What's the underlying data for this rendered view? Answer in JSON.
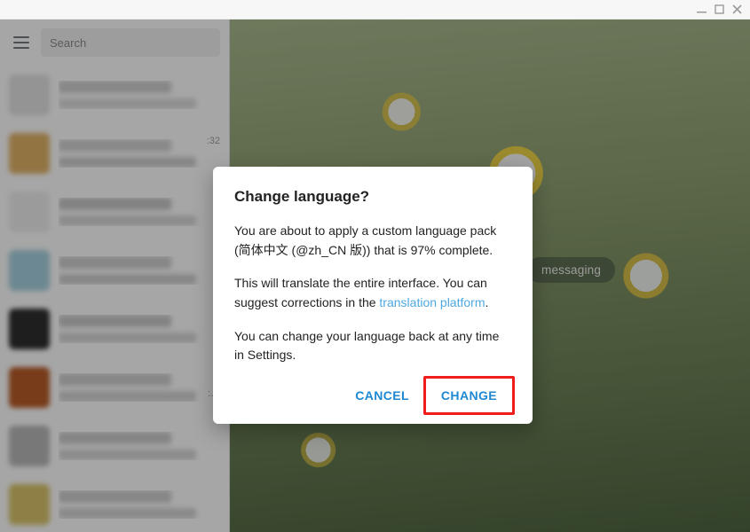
{
  "window": {
    "title": ""
  },
  "sidebar": {
    "search_placeholder": "Search",
    "chats": [
      {
        "time": "",
        "avatar_bg": "#e3e3e3",
        "title_bg": "#cfcfcf",
        "preview_bg": "#dcdcdc"
      },
      {
        "time": ":32",
        "avatar_bg": "#e1b368",
        "title_bg": "#d3d3d3",
        "preview_bg": "#cfcfcf"
      },
      {
        "time": "",
        "avatar_bg": "#efefef",
        "title_bg": "#c8c8c8",
        "preview_bg": "#d7d7d7"
      },
      {
        "time": "",
        "avatar_bg": "#a7d2e0",
        "title_bg": "#cfcfcf",
        "preview_bg": "#d0d0d0"
      },
      {
        "time": "",
        "avatar_bg": "#2e2e2e",
        "title_bg": "#cacaca",
        "preview_bg": "#d8d8d8"
      },
      {
        "time": "",
        "avatar_bg": "#b85c28",
        "title_bg": "#cfcfcf",
        "preview_bg": "#d4d4d4",
        "dots": ":…"
      },
      {
        "time": "",
        "avatar_bg": "#b9b9b9",
        "title_bg": "#cdcdcd",
        "preview_bg": "#d7d7d7"
      },
      {
        "time": "",
        "avatar_bg": "#d9c46a",
        "title_bg": "#cfcfcf",
        "preview_bg": "#d4d4d4"
      }
    ]
  },
  "main": {
    "welcome_text": "messaging"
  },
  "dialog": {
    "title": "Change language?",
    "p1_a": "You are about to apply a custom language pack (",
    "p1_b": "简体中文 (@zh_CN 版)",
    "p1_c": ") that is 97% complete.",
    "p2_a": "This will translate the entire interface. You can suggest corrections in the ",
    "p2_link": "translation platform",
    "p2_b": ".",
    "p3": "You can change your language back at any time in Settings.",
    "cancel": "CANCEL",
    "confirm": "CHANGE"
  }
}
